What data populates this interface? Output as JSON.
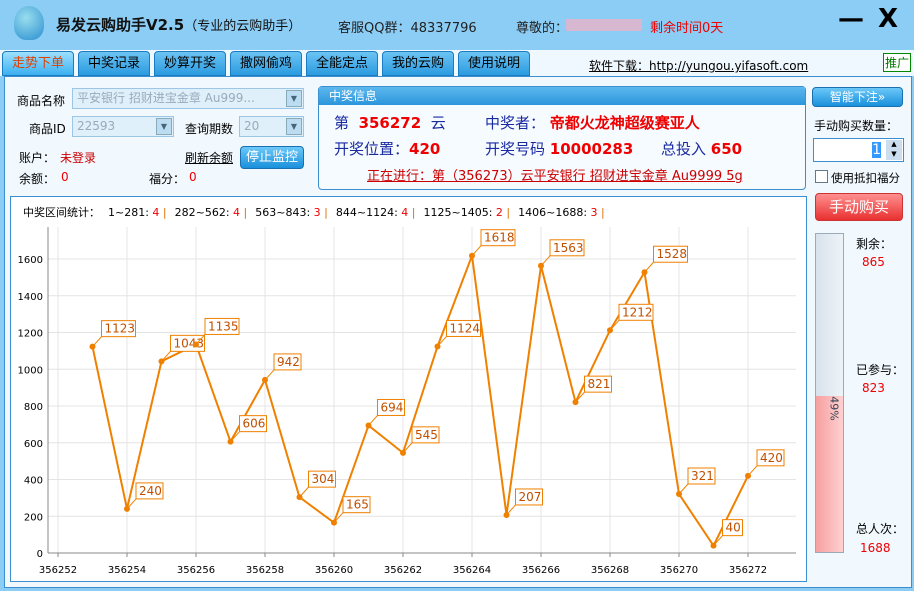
{
  "app": {
    "title": "易发云购助手V2.5",
    "subtitle": "（专业的云购助手）",
    "qq": "客服QQ群：48337796",
    "greeting": "尊敬的：",
    "remaining_time": "剩余时间0天",
    "minimize": "—",
    "close": "X"
  },
  "tabs": [
    {
      "label": "走势下单",
      "active": true
    },
    {
      "label": "中奖记录"
    },
    {
      "label": "妙算开奖"
    },
    {
      "label": "撒网偷鸡"
    },
    {
      "label": "全能定点"
    },
    {
      "label": "我的云购"
    },
    {
      "label": "使用说明"
    }
  ],
  "download": "软件下载：http://yungou.yifasoft.com",
  "promo": "推广",
  "form": {
    "product_name_label": "商品名称",
    "product_name": "平安银行 招财进宝金章 Au999...",
    "product_id_label": "商品ID",
    "product_id": "22593",
    "periods_label": "查询期数",
    "periods": "20",
    "account_label": "账户：",
    "account": "未登录",
    "refresh": "刷新余额",
    "stop": "停止监控",
    "balance_label": "余额：",
    "balance": "0",
    "points_label": "福分：",
    "points": "0"
  },
  "winner": {
    "header": "中奖信息",
    "di": "第",
    "period": "356272",
    "yun": "云",
    "winner_label": "中奖者：",
    "winner": "帝都火龙神超级赛亚人",
    "pos_label": "开奖位置：",
    "pos": "420",
    "num_label": "开奖号码",
    "num": "10000283",
    "invest_label": "总投入",
    "invest": "650",
    "ongoing": "正在进行：第（356273）云平安银行 招财进宝金章 Au9999 5g"
  },
  "stats": {
    "label": "中奖区间统计：",
    "ranges": [
      {
        "r": "1~281:",
        "c": "4"
      },
      {
        "r": "282~562:",
        "c": "4"
      },
      {
        "r": "563~843:",
        "c": "3"
      },
      {
        "r": "844~1124:",
        "c": "4"
      },
      {
        "r": "1125~1405:",
        "c": "2"
      },
      {
        "r": "1406~1688:",
        "c": "3"
      }
    ]
  },
  "side": {
    "smart": "智能下注»",
    "qty_label": "手动购买数量：",
    "qty": "1",
    "use_points": "使用抵扣福分",
    "buy": "手动购买",
    "remain_label": "剩余：",
    "remain": "865",
    "joined_label": "已参与：",
    "joined": "823",
    "total_label": "总人次：",
    "total": "1688",
    "progress_pct": 49,
    "progress_text": "49%"
  },
  "colors": {
    "line": "#f08000",
    "accent": "#e00000"
  },
  "chart_data": {
    "type": "line",
    "x": [
      356253,
      356254,
      356255,
      356256,
      356257,
      356258,
      356259,
      356260,
      356261,
      356262,
      356263,
      356264,
      356265,
      356266,
      356267,
      356268,
      356269,
      356270,
      356271,
      356272
    ],
    "values": [
      1123,
      240,
      1043,
      1135,
      606,
      942,
      304,
      165,
      694,
      545,
      1124,
      1618,
      207,
      1563,
      821,
      1212,
      1528,
      321,
      40,
      420
    ],
    "xticks": [
      356252,
      356254,
      356256,
      356258,
      356260,
      356262,
      356264,
      356266,
      356268,
      356270,
      356272
    ],
    "yticks": [
      0,
      200,
      400,
      600,
      800,
      1000,
      1200,
      1400,
      1600
    ],
    "ylim": [
      0,
      1800
    ],
    "grid": true
  }
}
